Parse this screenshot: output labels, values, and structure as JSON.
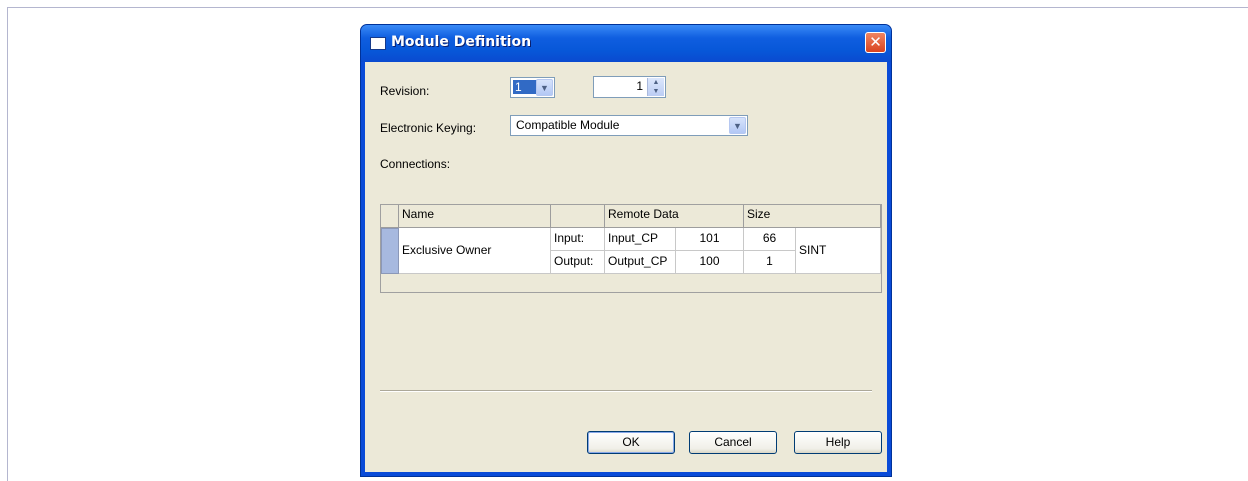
{
  "dialog": {
    "title": "Module Definition",
    "close_symbol": "✕",
    "title_icon": "window-icon"
  },
  "form": {
    "revision_label": "Revision:",
    "revision_major": "1",
    "revision_minor": "1",
    "keying_label": "Electronic Keying:",
    "keying_value": "Compatible Module",
    "connections_label": "Connections:"
  },
  "connections_table": {
    "headers": [
      "Name",
      "",
      "Remote Data",
      "Size"
    ],
    "rows": [
      {
        "name": "Exclusive Owner",
        "input_label": "Input:",
        "input_tag": "Input_CP",
        "input_instance": "101",
        "input_size": "66",
        "output_label": "Output:",
        "output_tag": "Output_CP",
        "output_instance": "100",
        "output_size": "1",
        "type": "SINT"
      }
    ]
  },
  "buttons": {
    "ok": "OK",
    "cancel": "Cancel",
    "help": "Help"
  },
  "colors": {
    "titlebar": "#0a4bd8",
    "client_background": "#ece9d8",
    "selection": "#316ac5",
    "close_button": "#d9431f"
  }
}
